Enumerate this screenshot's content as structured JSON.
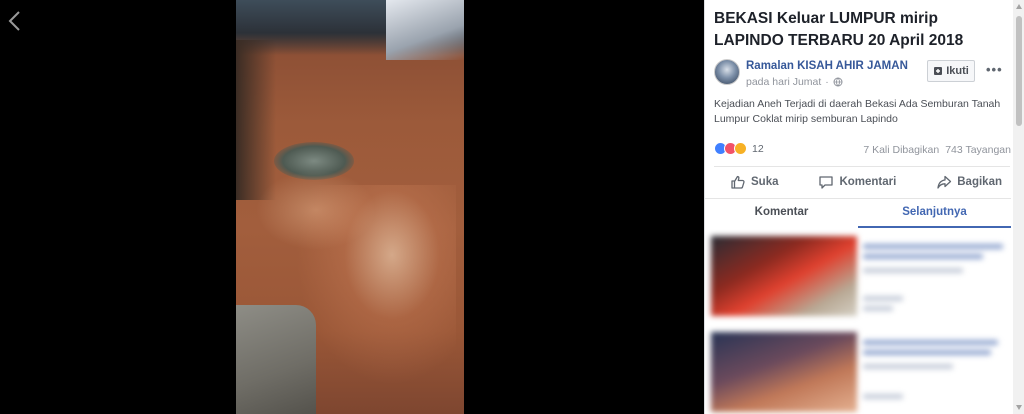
{
  "post": {
    "title": "BEKASI Keluar LUMPUR mirip LAPINDO TERBARU 20 April 2018",
    "author": "Ramalan KISAH AHIR JAMAN",
    "time": "pada hari Jumat",
    "follow_label": "Ikuti",
    "more_label": "•••",
    "text": "Kejadian Aneh Terjadi di daerah Bekasi Ada Semburan Tanah Lumpur Coklat mirip semburan Lapindo"
  },
  "stats": {
    "reaction_count": "12",
    "shares": "7 Kali Dibagikan",
    "views": "743 Tayangan"
  },
  "actions": {
    "like": "Suka",
    "comment": "Komentari",
    "share": "Bagikan"
  },
  "tabs": {
    "comments": "Komentar",
    "next": "Selanjutnya"
  },
  "colors": {
    "link": "#365899",
    "accent": "#4267b2",
    "like": "#4080ff",
    "love": "#f25268",
    "wow": "#f7b125"
  },
  "icons": {
    "back": "chevron-left-icon",
    "globe": "globe-icon",
    "follow": "follow-plus-icon",
    "like": "thumbs-up-icon",
    "comment": "comment-bubble-icon",
    "share": "share-arrow-icon"
  }
}
